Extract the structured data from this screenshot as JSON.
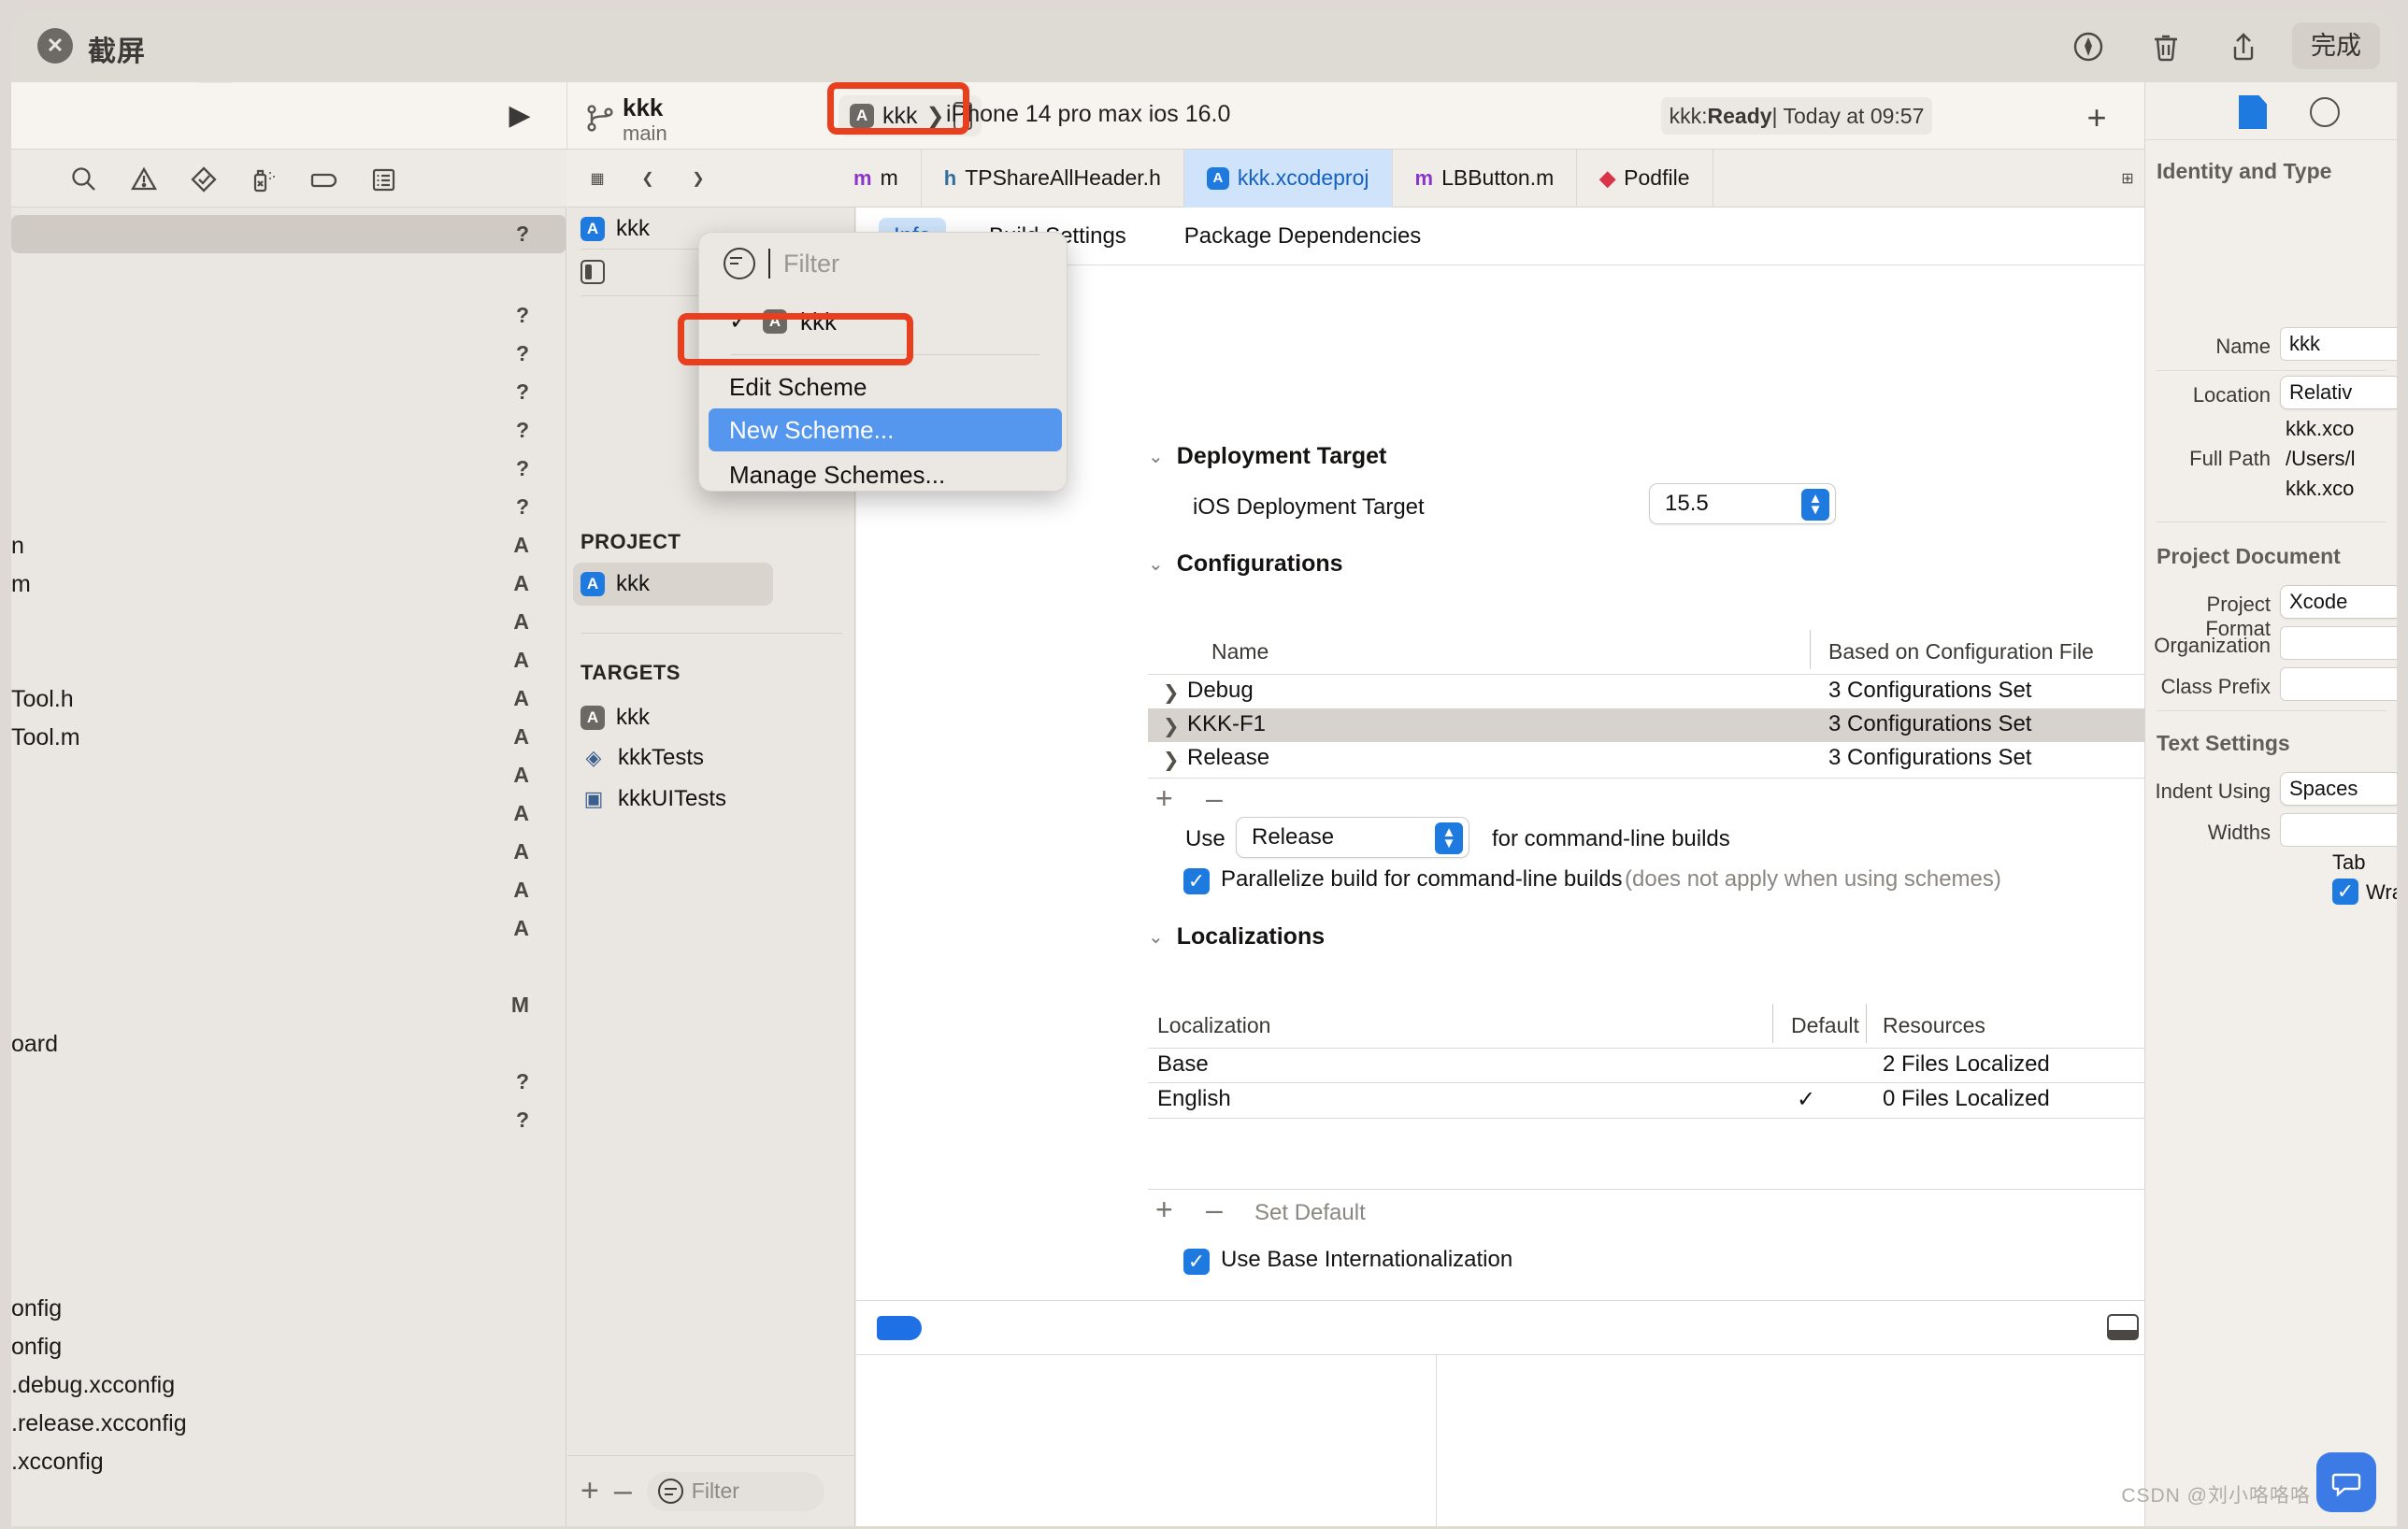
{
  "screenshot_window": {
    "title": "截屏",
    "close_label": "✕",
    "tools": [
      {
        "name": "markup-icon",
        "label": "markup"
      },
      {
        "name": "trash-icon",
        "label": "delete"
      },
      {
        "name": "share-icon",
        "label": "share"
      }
    ],
    "done_label": "完成"
  },
  "toolbar": {
    "run_glyph": "▶",
    "scheme_name": "kkk",
    "branch": "main",
    "scheme_selector_label": "kkk",
    "scheme_chevron": "❯",
    "device": "iPhone 14 pro max ios 16.0",
    "status_prefix": "kkk: ",
    "status_state": "Ready",
    "status_suffix": " | Today at 09:57",
    "add_glyph": "+"
  },
  "navigator_filters": [
    {
      "name": "search-icon"
    },
    {
      "name": "warning-triangle-icon"
    },
    {
      "name": "checkmark-diamond-icon"
    },
    {
      "name": "source-control-icon"
    },
    {
      "name": "tag-icon"
    },
    {
      "name": "list-icon"
    }
  ],
  "file_navigator": {
    "rows": [
      {
        "name": "",
        "status": "?",
        "selected": true
      },
      {
        "name": "",
        "status": ""
      },
      {
        "name": "",
        "status": "?"
      },
      {
        "name": "",
        "status": "?"
      },
      {
        "name": "",
        "status": "?"
      },
      {
        "name": "",
        "status": "?"
      },
      {
        "name": "",
        "status": "?"
      },
      {
        "name": "",
        "status": "?"
      },
      {
        "name": "n",
        "status": "A"
      },
      {
        "name": "m",
        "status": "A"
      },
      {
        "name": "",
        "status": "A"
      },
      {
        "name": "",
        "status": "A"
      },
      {
        "name": "Tool.h",
        "status": "A"
      },
      {
        "name": "Tool.m",
        "status": "A"
      },
      {
        "name": "",
        "status": "A"
      },
      {
        "name": "",
        "status": "A"
      },
      {
        "name": "",
        "status": "A"
      },
      {
        "name": "",
        "status": "A"
      },
      {
        "name": "",
        "status": "A"
      },
      {
        "name": "",
        "status": ""
      },
      {
        "name": "",
        "status": "M"
      },
      {
        "name": "oard",
        "status": ""
      },
      {
        "name": "",
        "status": "?"
      },
      {
        "name": "",
        "status": "?"
      },
      {
        "name": "",
        "status": ""
      },
      {
        "name": "",
        "status": ""
      },
      {
        "name": "",
        "status": ""
      },
      {
        "name": "onfig",
        "status": ""
      },
      {
        "name": "onfig",
        "status": ""
      },
      {
        "name": ".debug.xcconfig",
        "status": ""
      },
      {
        "name": ".release.xcconfig",
        "status": ""
      },
      {
        "name": ".xcconfig",
        "status": ""
      }
    ]
  },
  "tab_bar": {
    "nav_buttons": [
      {
        "name": "layout-icon",
        "glyph": "▦"
      },
      {
        "name": "back-icon",
        "glyph": "❮"
      },
      {
        "name": "forward-icon",
        "glyph": "❯"
      }
    ],
    "tabs": [
      {
        "label": "m",
        "icon": "m",
        "icon_color": "#8a36c9",
        "active": false
      },
      {
        "label": "TPShareAllHeader.h",
        "icon": "h",
        "icon_color": "#2f6e9e",
        "active": false
      },
      {
        "label": "kkk.xcodeproj",
        "icon": "A",
        "icon_color": "#1f7ae0",
        "active": true
      },
      {
        "label": "LBButton.m",
        "icon": "m",
        "icon_color": "#8a36c9",
        "active": false
      },
      {
        "label": "Podfile",
        "icon": "◆",
        "icon_color": "#d9344a",
        "active": false
      }
    ],
    "right_button": {
      "name": "inspector-toggle-icon",
      "glyph": "⊞"
    }
  },
  "project_navigator": {
    "top_items": [
      {
        "label": "kkk",
        "icon": "A"
      },
      {
        "label": "",
        "icon": "▯"
      }
    ],
    "project_header": "PROJECT",
    "projects": [
      {
        "label": "kkk",
        "icon": "A",
        "selected": true
      }
    ],
    "targets_header": "TARGETS",
    "targets": [
      {
        "label": "kkk",
        "icon": "A"
      },
      {
        "label": "kkkTests",
        "icon": "◈"
      },
      {
        "label": "kkkUITests",
        "icon": "▣"
      }
    ],
    "bottom": {
      "add_glyph": "+",
      "remove_glyph": "–",
      "filter_placeholder": "Filter"
    }
  },
  "scheme_popup": {
    "filter_placeholder": "Filter",
    "schemes": [
      {
        "label": "kkk",
        "checked": true,
        "check_glyph": "✓"
      }
    ],
    "actions": [
      {
        "label": "Edit Scheme",
        "highlighted": false
      },
      {
        "label": "New Scheme...",
        "highlighted": true
      },
      {
        "label": "Manage Schemes...",
        "highlighted": false
      }
    ]
  },
  "editor": {
    "tabs": [
      {
        "label": "Info",
        "active": true
      },
      {
        "label": "Build Settings",
        "active": false
      },
      {
        "label": "Package Dependencies",
        "active": false
      }
    ],
    "deployment": {
      "section_title": "Deployment Target",
      "field_label": "iOS Deployment Target",
      "value": "15.5"
    },
    "configurations": {
      "section_title": "Configurations",
      "columns": [
        "Name",
        "Based on Configuration File"
      ],
      "rows": [
        {
          "name": "Debug",
          "based_on": "3 Configurations Set",
          "selected": false
        },
        {
          "name": "KKK-F1",
          "based_on": "3 Configurations Set",
          "selected": true
        },
        {
          "name": "Release",
          "based_on": "3 Configurations Set",
          "selected": false
        }
      ],
      "add_glyph": "+",
      "remove_glyph": "–",
      "use_prefix": "Use",
      "use_value": "Release",
      "use_suffix": "for command-line builds",
      "parallelize_label": "Parallelize build for command-line builds",
      "parallelize_note": "(does not apply when using schemes)",
      "parallelize_checked": true,
      "check_glyph": "✓"
    },
    "localizations": {
      "section_title": "Localizations",
      "columns": [
        "Localization",
        "Default",
        "Resources"
      ],
      "rows": [
        {
          "localization": "Base",
          "default": "",
          "resources": "2 Files Localized"
        },
        {
          "localization": "English",
          "default": "✓",
          "resources": "0 Files Localized"
        }
      ],
      "add_glyph": "+",
      "remove_glyph": "–",
      "set_default_label": "Set Default",
      "base_intl_label": "Use Base Internationalization",
      "base_intl_checked": true,
      "check_glyph": "✓"
    }
  },
  "inspector": {
    "identity": {
      "section_title": "Identity and Type",
      "name_label": "Name",
      "name_value": "kkk",
      "location_label": "Location",
      "location_value": "Relativ",
      "location_file": "kkk.xco",
      "fullpath_label": "Full Path",
      "fullpath_line1": "/Users/l",
      "fullpath_line2": "kkk.xco"
    },
    "project_document": {
      "section_title": "Project Document",
      "format_label": "Project Format",
      "format_value": "Xcode",
      "organization_label": "Organization",
      "organization_value": "",
      "class_prefix_label": "Class Prefix",
      "class_prefix_value": ""
    },
    "text_settings": {
      "section_title": "Text Settings",
      "indent_label": "Indent Using",
      "indent_value": "Spaces",
      "widths_label": "Widths",
      "widths_value": "",
      "tab_label": "Tab",
      "wrap_label": "Wrap",
      "wrap_checked": true,
      "check_glyph": "✓"
    }
  },
  "watermark": "CSDN @刘小咯咯咯"
}
